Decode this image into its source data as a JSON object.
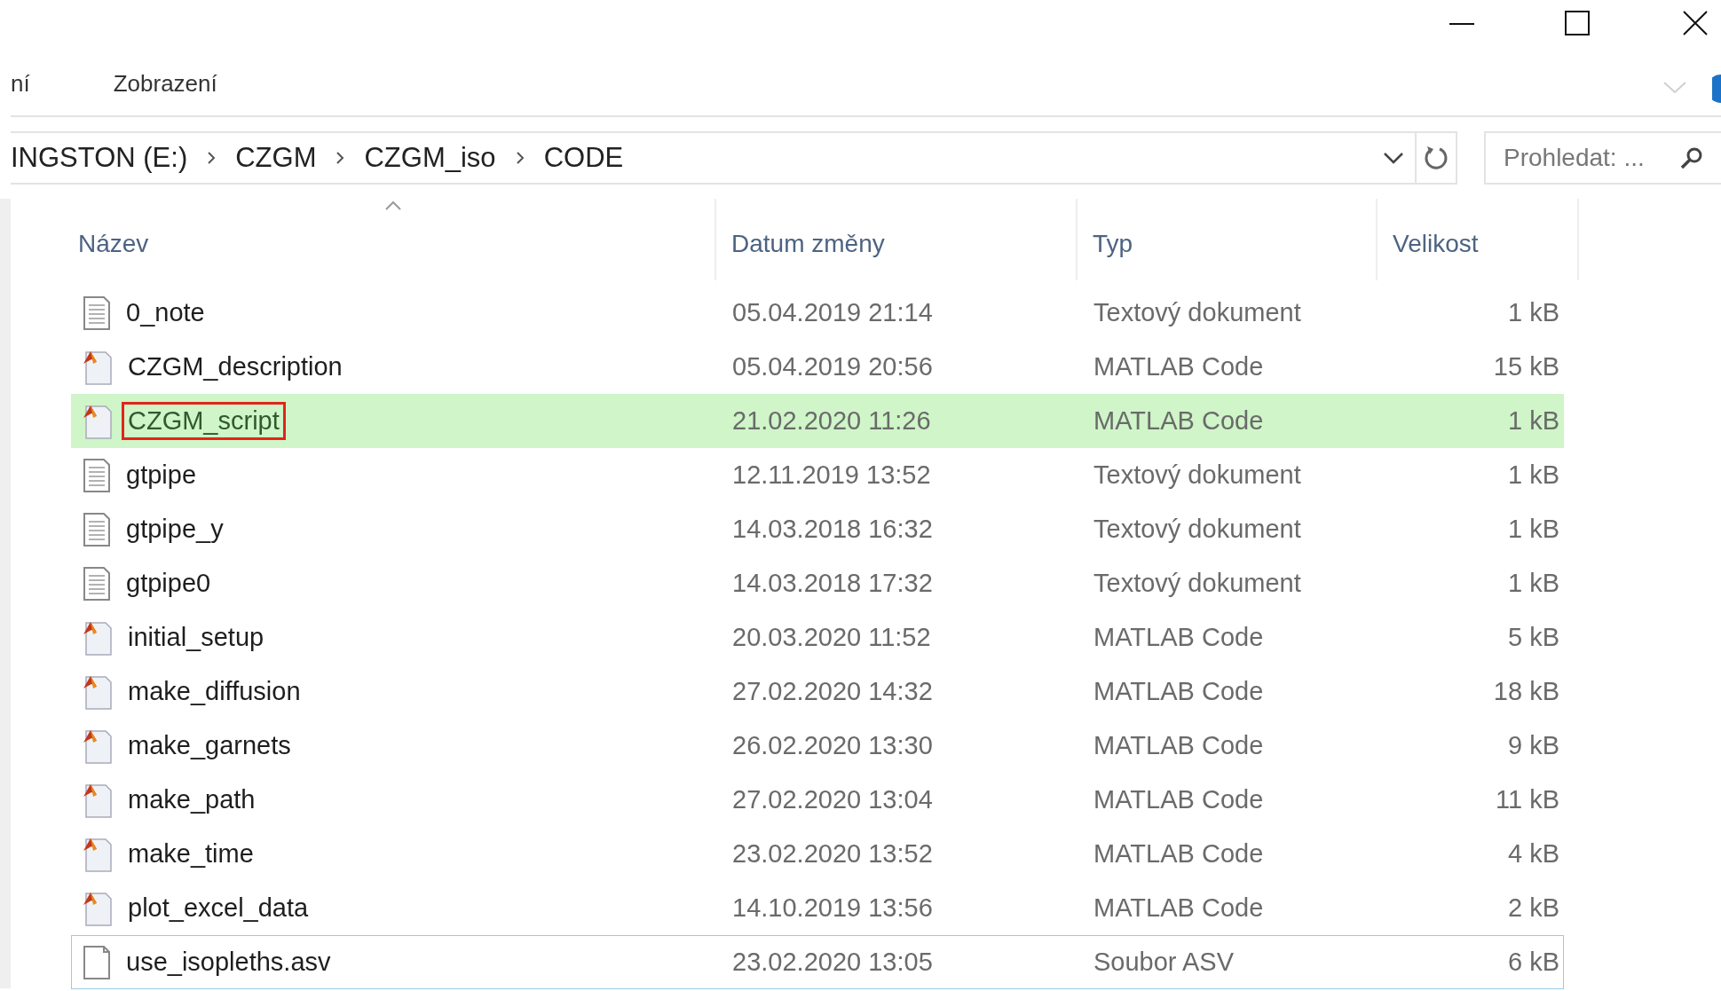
{
  "ribbon": {
    "tabs": [
      {
        "label": "ní"
      },
      {
        "label": "Zobrazení"
      }
    ]
  },
  "address_bar": {
    "path": [
      "INGSTON (E:)",
      "CZGM",
      "CZGM_iso",
      "CODE"
    ]
  },
  "search": {
    "placeholder": "Prohledat: ..."
  },
  "table": {
    "columns": [
      {
        "label": "Název",
        "sorted": true
      },
      {
        "label": "Datum změny",
        "sorted": false
      },
      {
        "label": "Typ",
        "sorted": false
      },
      {
        "label": "Velikost",
        "sorted": false
      }
    ],
    "rows": [
      {
        "kind": "text",
        "name": "0_note",
        "date": "05.04.2019 21:14",
        "type": "Textový dokument",
        "size": "1 kB",
        "highlighted": false,
        "marked": false,
        "focused": false
      },
      {
        "kind": "matlab",
        "name": "CZGM_description",
        "date": "05.04.2019 20:56",
        "type": "MATLAB Code",
        "size": "15 kB",
        "highlighted": false,
        "marked": false,
        "focused": false
      },
      {
        "kind": "matlab",
        "name": "CZGM_script",
        "date": "21.02.2020 11:26",
        "type": "MATLAB Code",
        "size": "1 kB",
        "highlighted": true,
        "marked": true,
        "focused": false
      },
      {
        "kind": "text",
        "name": "gtpipe",
        "date": "12.11.2019 13:52",
        "type": "Textový dokument",
        "size": "1 kB",
        "highlighted": false,
        "marked": false,
        "focused": false
      },
      {
        "kind": "text",
        "name": "gtpipe_y",
        "date": "14.03.2018 16:32",
        "type": "Textový dokument",
        "size": "1 kB",
        "highlighted": false,
        "marked": false,
        "focused": false
      },
      {
        "kind": "text",
        "name": "gtpipe0",
        "date": "14.03.2018 17:32",
        "type": "Textový dokument",
        "size": "1 kB",
        "highlighted": false,
        "marked": false,
        "focused": false
      },
      {
        "kind": "matlab",
        "name": "initial_setup",
        "date": "20.03.2020 11:52",
        "type": "MATLAB Code",
        "size": "5 kB",
        "highlighted": false,
        "marked": false,
        "focused": false
      },
      {
        "kind": "matlab",
        "name": "make_diffusion",
        "date": "27.02.2020 14:32",
        "type": "MATLAB Code",
        "size": "18 kB",
        "highlighted": false,
        "marked": false,
        "focused": false
      },
      {
        "kind": "matlab",
        "name": "make_garnets",
        "date": "26.02.2020 13:30",
        "type": "MATLAB Code",
        "size": "9 kB",
        "highlighted": false,
        "marked": false,
        "focused": false
      },
      {
        "kind": "matlab",
        "name": "make_path",
        "date": "27.02.2020 13:04",
        "type": "MATLAB Code",
        "size": "11 kB",
        "highlighted": false,
        "marked": false,
        "focused": false
      },
      {
        "kind": "matlab",
        "name": "make_time",
        "date": "23.02.2020 13:52",
        "type": "MATLAB Code",
        "size": "4 kB",
        "highlighted": false,
        "marked": false,
        "focused": false
      },
      {
        "kind": "matlab",
        "name": "plot_excel_data",
        "date": "14.10.2019 13:56",
        "type": "MATLAB Code",
        "size": "2 kB",
        "highlighted": false,
        "marked": false,
        "focused": false
      },
      {
        "kind": "file",
        "name": "use_isopleths.asv",
        "date": "23.02.2020 13:05",
        "type": "Soubor ASV",
        "size": "6 kB",
        "highlighted": false,
        "marked": false,
        "focused": true
      }
    ]
  }
}
